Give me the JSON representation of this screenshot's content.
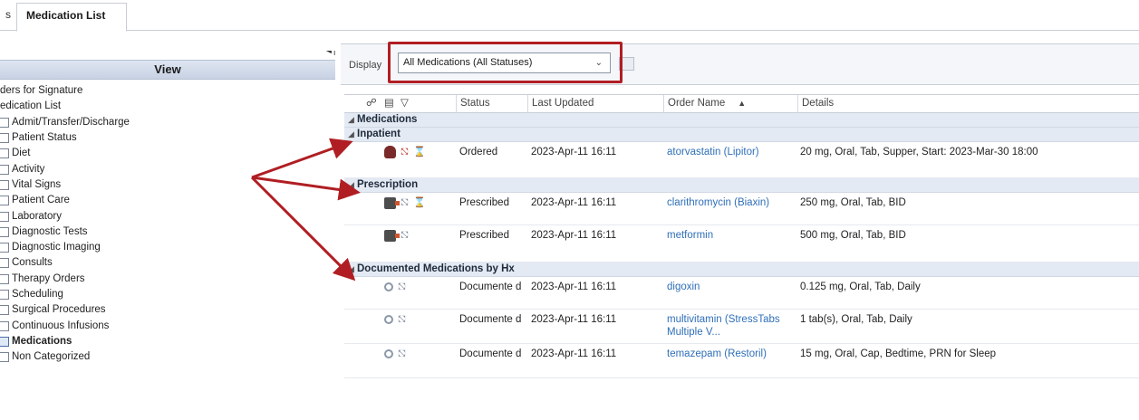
{
  "tab": {
    "prefix": "s",
    "label": "Medication List"
  },
  "view_panel": {
    "title": "View",
    "collapse_icon": "collapse-left-icon",
    "top_items": [
      {
        "label": "ders for Signature"
      },
      {
        "label": "edication List"
      }
    ],
    "items": [
      {
        "label": "Admit/Transfer/Discharge",
        "checked": false
      },
      {
        "label": "Patient Status",
        "checked": false
      },
      {
        "label": "Diet",
        "checked": false
      },
      {
        "label": "Activity",
        "checked": false
      },
      {
        "label": "Vital Signs",
        "checked": false
      },
      {
        "label": "Patient Care",
        "checked": false
      },
      {
        "label": "Laboratory",
        "checked": false
      },
      {
        "label": "Diagnostic Tests",
        "checked": false
      },
      {
        "label": "Diagnostic Imaging",
        "checked": false
      },
      {
        "label": "Consults",
        "checked": false
      },
      {
        "label": "Therapy Orders",
        "checked": false
      },
      {
        "label": "Scheduling",
        "checked": false
      },
      {
        "label": "Surgical Procedures",
        "checked": false
      },
      {
        "label": "Continuous Infusions",
        "checked": false
      },
      {
        "label": "Medications",
        "checked": true
      },
      {
        "label": "Non Categorized",
        "checked": false
      }
    ]
  },
  "toolbar": {
    "display_label": "Display",
    "display_value": "All Medications (All Statuses)",
    "highlight_color": "#b01e23"
  },
  "grid": {
    "columns": {
      "status": "Status",
      "last_updated": "Last Updated",
      "order_name": "Order Name",
      "details": "Details"
    },
    "header_icons": [
      "link-icon",
      "document-icon",
      "filter-icon"
    ],
    "groups": {
      "medications": "Medications",
      "inpatient": "Inpatient",
      "prescription": "Prescription",
      "documented": "Documented Medications by Hx"
    },
    "inpatient_rows": [
      {
        "status": "Ordered",
        "last_updated": "2023-Apr-11 16:11",
        "order_name": "atorvastatin (Lipitor)",
        "details": "20 mg, Oral, Tab, Supper, Start: 2023-Mar-30 18:00"
      }
    ],
    "prescription_rows": [
      {
        "status": "Prescribed",
        "last_updated": "2023-Apr-11 16:11",
        "order_name": "clarithromycin (Biaxin)",
        "details": "250 mg, Oral, Tab, BID"
      },
      {
        "status": "Prescribed",
        "last_updated": "2023-Apr-11 16:11",
        "order_name": "metformin",
        "details": "500 mg, Oral, Tab, BID"
      }
    ],
    "documented_rows": [
      {
        "status": "Documente d",
        "last_updated": "2023-Apr-11 16:11",
        "order_name": "digoxin",
        "details": "0.125 mg, Oral, Tab, Daily"
      },
      {
        "status": "Documente d",
        "last_updated": "2023-Apr-11 16:11",
        "order_name": "multivitamin (StressTabs Multiple V...",
        "details": "1 tab(s), Oral, Tab, Daily"
      },
      {
        "status": "Documente d",
        "last_updated": "2023-Apr-11 16:11",
        "order_name": "temazepam (Restoril)",
        "details": "15 mg, Oral, Cap, Bedtime, PRN for Sleep"
      }
    ]
  },
  "annotation": {
    "arrow_color": "#b01e23"
  }
}
